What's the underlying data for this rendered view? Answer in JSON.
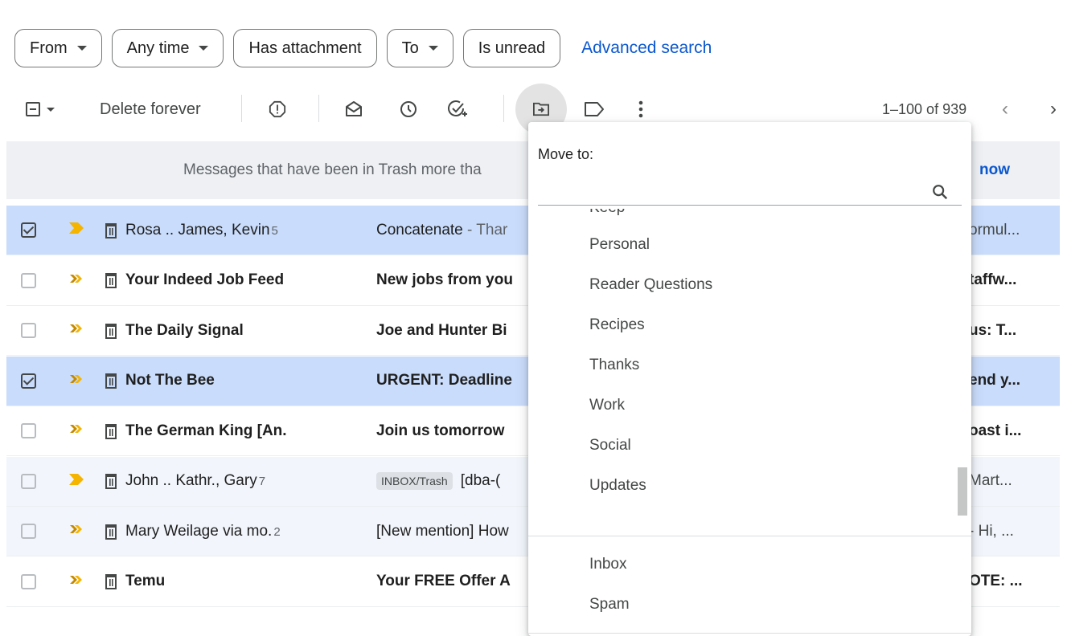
{
  "filters": {
    "from": "From",
    "any_time": "Any time",
    "has_attachment": "Has attachment",
    "to": "To",
    "is_unread": "Is unread",
    "advanced_search": "Advanced search"
  },
  "toolbar": {
    "delete_forever": "Delete forever",
    "pager": "1–100 of 939"
  },
  "banner": {
    "text": "Messages that have been in Trash more tha",
    "link": "now"
  },
  "rows": [
    {
      "sender": "Rosa .. James, Kevin",
      "count": "5",
      "subject": "Concatenate",
      "subject_rest": " - Thar",
      "snippet": "ormul...",
      "selected": true,
      "bold": false,
      "imp_style": "single"
    },
    {
      "sender": "Your Indeed Job Feed",
      "count": "",
      "subject": "New jobs from you",
      "subject_rest": "",
      "snippet": "taffw...",
      "selected": false,
      "bold": true,
      "imp_style": "double"
    },
    {
      "sender": "The Daily Signal",
      "count": "",
      "subject": "Joe and Hunter Bi",
      "subject_rest": "",
      "snippet": "us: T...",
      "selected": false,
      "bold": true,
      "imp_style": "double"
    },
    {
      "sender": "Not The Bee",
      "count": "",
      "subject": "URGENT: Deadline",
      "subject_rest": "",
      "snippet": "end y...",
      "selected": true,
      "bold": true,
      "imp_style": "double"
    },
    {
      "sender": "The German King [An.",
      "count": "",
      "subject": "Join us tomorrow",
      "subject_rest": "",
      "snippet": "oast i...",
      "selected": false,
      "bold": true,
      "imp_style": "double"
    },
    {
      "sender": "John .. Kathr., Gary",
      "count": "7",
      "tag": "INBOX/Trash",
      "subject": "[dba-(",
      "subject_rest": "",
      "snippet": "Mart...",
      "selected": false,
      "bold": false,
      "imp_style": "single"
    },
    {
      "sender": "Mary Weilage via mo.",
      "count": "2",
      "subject": "[New mention] How",
      "subject_rest": "",
      "snippet": "- Hi, ...",
      "selected": false,
      "bold": false,
      "imp_style": "double"
    },
    {
      "sender": "Temu",
      "count": "",
      "subject": "Your FREE Offer A",
      "subject_rest": "",
      "snippet": "OTE: ...",
      "selected": false,
      "bold": true,
      "imp_style": "double"
    }
  ],
  "move_menu": {
    "title": "Move to:",
    "search_placeholder": "",
    "partial_item": "Keep",
    "labels": [
      "Personal",
      "Reader Questions",
      "Recipes",
      "Thanks",
      "Work",
      "Social",
      "Updates"
    ],
    "system": [
      "Inbox",
      "Spam"
    ]
  },
  "colors": {
    "accent": "#0b57d0",
    "important_marker": "#f4b400",
    "selected_row": "#c9dcfb"
  }
}
